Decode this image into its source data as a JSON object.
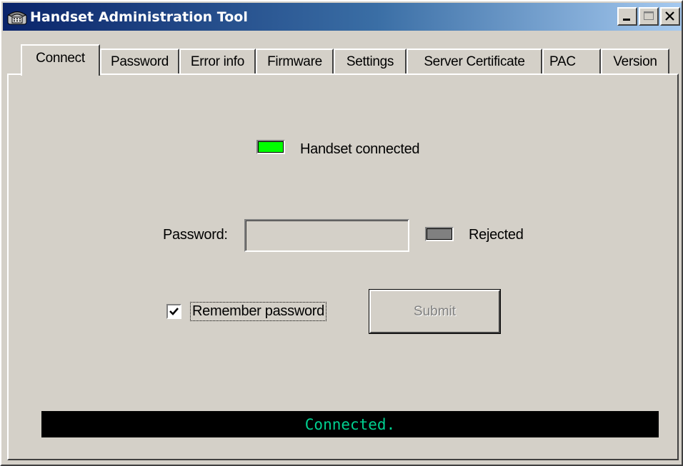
{
  "window": {
    "title": "Handset Administration Tool",
    "icon": "telephone-icon",
    "controls": [
      "minimize-icon",
      "maximize-icon",
      "close-icon"
    ]
  },
  "tabs": [
    {
      "label": "Connect",
      "active": true
    },
    {
      "label": "Password",
      "active": false
    },
    {
      "label": "Error info",
      "active": false
    },
    {
      "label": "Firmware",
      "active": false
    },
    {
      "label": "Settings",
      "active": false
    },
    {
      "label": "Server Certificate",
      "active": false
    },
    {
      "label": "PAC",
      "active": false
    },
    {
      "label": "Version",
      "active": false
    }
  ],
  "connect": {
    "handset_status": {
      "label": "Handset connected",
      "indicator_color": "#00ff00"
    },
    "password": {
      "label": "Password:",
      "value": "",
      "placeholder": ""
    },
    "rejected": {
      "label": "Rejected",
      "indicator_color": "#808080"
    },
    "remember": {
      "label": "Remember password",
      "checked": true
    },
    "submit": {
      "label": "Submit",
      "enabled": false
    },
    "status_text": "Connected.",
    "status_color": "#00d090"
  }
}
